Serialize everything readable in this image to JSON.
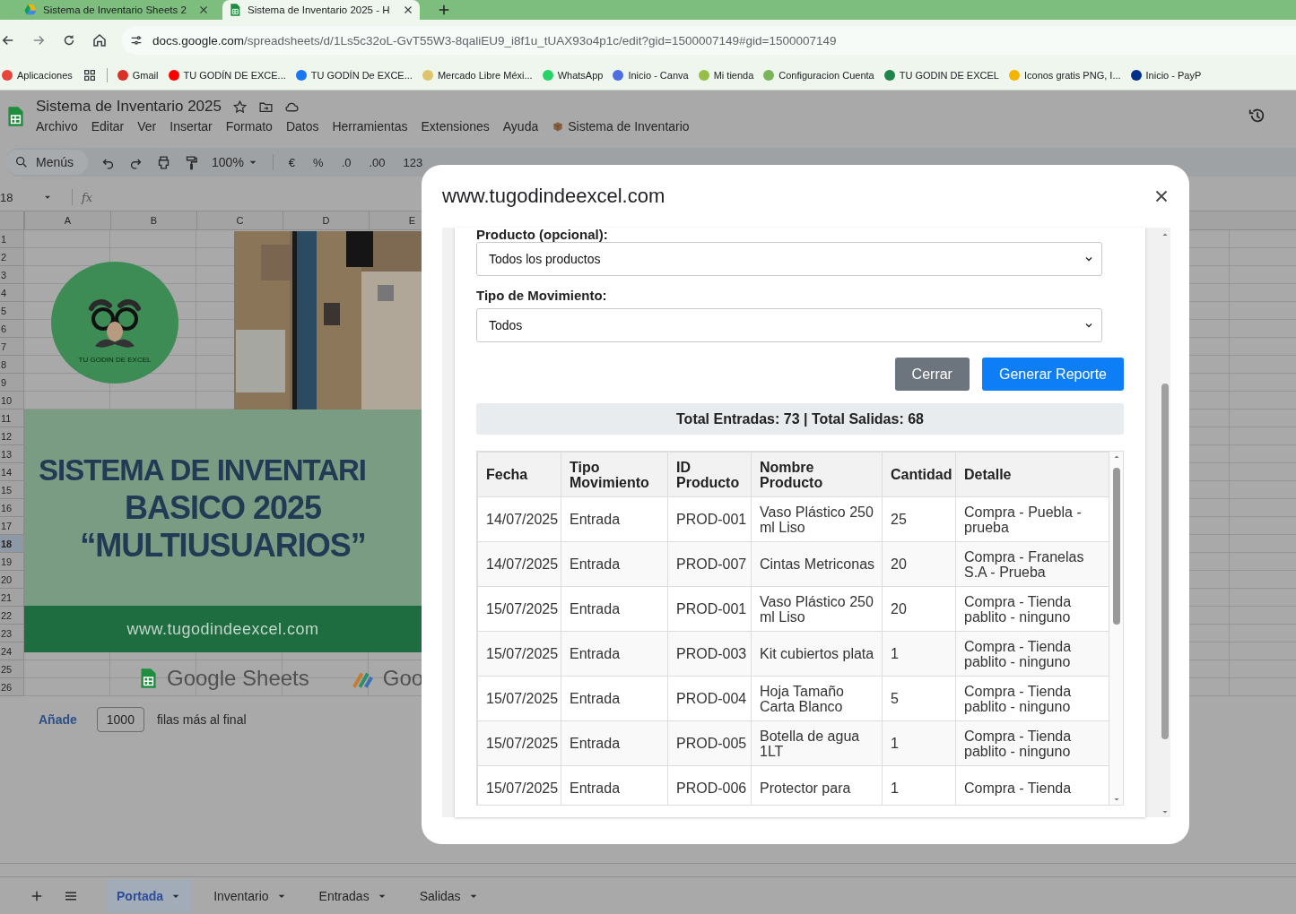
{
  "browser": {
    "tabs": [
      {
        "title": "Sistema de Inventario Sheets 2",
        "selected": false
      },
      {
        "title": "Sistema de Inventario 2025 - H",
        "selected": true
      }
    ],
    "url_host": "docs.google.com",
    "url_path": "/spreadsheets/d/1Ls5c32oL-GvT55W3-8qaliEU9_i8f1u_tUAX93o4p1c/edit?gid=1500007149#gid=1500007149",
    "bookmarks": [
      {
        "label": "Aplicaciones",
        "color": "#e8453c"
      },
      {
        "label": "Gmail",
        "color": "#d93025"
      },
      {
        "label": "TU GODÍN DE EXCE...",
        "color": "#ff0000"
      },
      {
        "label": "TU GODÍN De EXCE...",
        "color": "#1877f2"
      },
      {
        "label": "Mercado Libre Méxi...",
        "color": "#e0c36a"
      },
      {
        "label": "WhatsApp",
        "color": "#25d366"
      },
      {
        "label": "Inicio - Canva",
        "color": "#4f6fe0"
      },
      {
        "label": "Mi tienda",
        "color": "#95bf47"
      },
      {
        "label": "Configuracion Cuenta",
        "color": "#7ab55c"
      },
      {
        "label": "TU GODIN DE EXCEL",
        "color": "#1e8449"
      },
      {
        "label": "Iconos gratis PNG, I...",
        "color": "#f4b400"
      },
      {
        "label": "Inicio - PayP",
        "color": "#003087"
      }
    ]
  },
  "sheets": {
    "title": "Sistema de Inventario 2025",
    "menu": [
      "Archivo",
      "Editar",
      "Ver",
      "Insertar",
      "Formato",
      "Datos",
      "Herramientas",
      "Extensiones",
      "Ayuda"
    ],
    "addon_menu": "Sistema de Inventario",
    "toolbar": {
      "search": "Menús",
      "zoom": "100%",
      "format_buttons": [
        "€",
        "%",
        ".0",
        ".00",
        "123"
      ]
    },
    "name_box": "18",
    "formula_label": "fx",
    "columns": [
      "A",
      "B",
      "C",
      "D",
      "E"
    ],
    "rows": [
      {
        "label": "1",
        "selected": false
      },
      {
        "label": "2",
        "selected": false
      },
      {
        "label": "3",
        "selected": false
      },
      {
        "label": "4",
        "selected": false
      },
      {
        "label": "5",
        "selected": false
      },
      {
        "label": "6",
        "selected": false
      },
      {
        "label": "7",
        "selected": false
      },
      {
        "label": "8",
        "selected": false
      },
      {
        "label": "9",
        "selected": false
      },
      {
        "label": "10",
        "selected": false
      },
      {
        "label": "11",
        "selected": false
      },
      {
        "label": "12",
        "selected": false
      },
      {
        "label": "13",
        "selected": false
      },
      {
        "label": "14",
        "selected": false
      },
      {
        "label": "15",
        "selected": false
      },
      {
        "label": "16",
        "selected": false
      },
      {
        "label": "17",
        "selected": false
      },
      {
        "label": "18",
        "selected": true
      },
      {
        "label": "19",
        "selected": false
      },
      {
        "label": "20",
        "selected": false
      },
      {
        "label": "21",
        "selected": false
      },
      {
        "label": "22",
        "selected": false
      },
      {
        "label": "23",
        "selected": false
      },
      {
        "label": "24",
        "selected": false
      },
      {
        "label": "25",
        "selected": false
      },
      {
        "label": "26",
        "selected": false
      }
    ],
    "cover": {
      "logo_text": "TU GODIN DE EXCEL",
      "headline": [
        "SISTEMA DE INVENTARI",
        "BASICO 2025",
        "“MULTIUSUARIOS”"
      ],
      "website": "www.tugodindeexcel.com",
      "brand": "Google Sheets",
      "brand_2": "Goo"
    },
    "add_rows": {
      "button": "Añade",
      "count": "1000",
      "suffix": "filas más al final"
    },
    "sheet_tabs": [
      {
        "label": "Portada",
        "selected": true
      },
      {
        "label": "Inventario",
        "selected": false
      },
      {
        "label": "Entradas",
        "selected": false
      },
      {
        "label": "Salidas",
        "selected": false
      }
    ]
  },
  "dialog": {
    "title": "www.tugodindeexcel.com",
    "fields": [
      {
        "label": "Producto (opcional):",
        "value": "Todos los productos"
      },
      {
        "label": "Tipo de Movimiento:",
        "value": "Todos"
      }
    ],
    "buttons": [
      {
        "label": "Cerrar",
        "kind": "secondary"
      },
      {
        "label": "Generar Reporte",
        "kind": "primary"
      }
    ],
    "summary": "Total Entradas: 73 | Total Salidas: 68",
    "table": {
      "columns": [
        "Fecha",
        "Tipo Movimiento",
        "ID Producto",
        "Nombre Producto",
        "Cantidad",
        "Detalle"
      ],
      "rows": [
        [
          "14/07/2025",
          "Entrada",
          "PROD-001",
          "Vaso Plástico 250 ml Liso",
          "25",
          "Compra - Puebla - prueba"
        ],
        [
          "14/07/2025",
          "Entrada",
          "PROD-007",
          "Cintas Metriconas",
          "20",
          "Compra - Franelas S.A - Prueba"
        ],
        [
          "15/07/2025",
          "Entrada",
          "PROD-001",
          "Vaso Plástico 250 ml Liso",
          "20",
          "Compra - Tienda pablito - ninguno"
        ],
        [
          "15/07/2025",
          "Entrada",
          "PROD-003",
          "Kit cubiertos plata",
          "1",
          "Compra - Tienda pablito - ninguno"
        ],
        [
          "15/07/2025",
          "Entrada",
          "PROD-004",
          "Hoja Tamaño Carta Blanco",
          "5",
          "Compra - Tienda pablito - ninguno"
        ],
        [
          "15/07/2025",
          "Entrada",
          "PROD-005",
          "Botella de agua 1LT",
          "1",
          "Compra - Tienda pablito - ninguno"
        ],
        [
          "15/07/2025",
          "Entrada",
          "PROD-006",
          "Protector para",
          "1",
          "Compra - Tienda"
        ]
      ]
    }
  }
}
